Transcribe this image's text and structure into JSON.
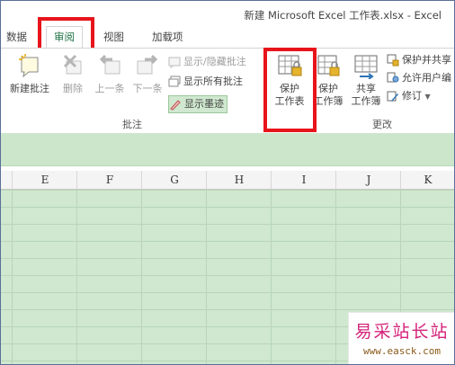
{
  "window": {
    "title": "新建 Microsoft Excel 工作表.xlsx - Excel"
  },
  "tabs": [
    {
      "label": "数据",
      "active": false
    },
    {
      "label": "审阅",
      "active": true
    },
    {
      "label": "视图",
      "active": false
    },
    {
      "label": "加载项",
      "active": false
    }
  ],
  "ribbon": {
    "comments_group": {
      "label": "批注",
      "new_comment": "新建批注",
      "delete": "删除",
      "previous": "上一条",
      "next": "下一条",
      "show_hide_comment": "显示/隐藏批注",
      "show_all_comments": "显示所有批注",
      "show_ink": "显示墨迹"
    },
    "changes_group": {
      "label": "更改",
      "protect_sheet_line1": "保护",
      "protect_sheet_line2": "工作表",
      "protect_workbook_line1": "保护",
      "protect_workbook_line2": "工作簿",
      "share_workbook_line1": "共享",
      "share_workbook_line2": "工作簿",
      "protect_and_share": "保护并共享",
      "allow_users_edit": "允许用户编",
      "track_changes": "修订"
    }
  },
  "columns": [
    "E",
    "F",
    "G",
    "H",
    "I",
    "J",
    "K"
  ],
  "watermark": {
    "title": "易采站长站",
    "url": "www.easck.com"
  },
  "colors": {
    "accent": "#217346",
    "highlight": "#e8141b",
    "sheet": "#cfe8cf"
  }
}
